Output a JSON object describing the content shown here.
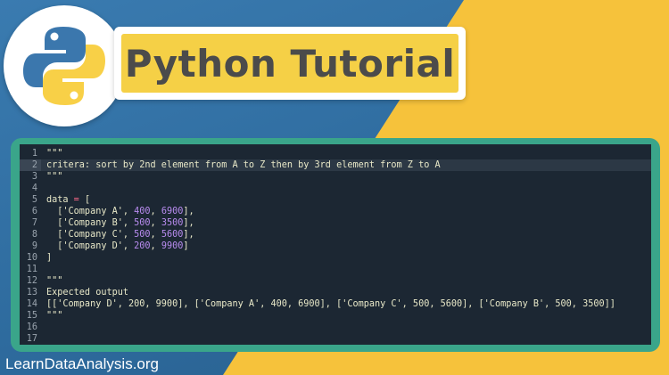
{
  "header": {
    "title": "Python Tutorial",
    "logo_icon": "python-logo-icon"
  },
  "colors": {
    "blue_bg": "#2e6b9e",
    "yellow_bg": "#f6c23b",
    "editor_bg": "#1c2733",
    "frame": "#3aa58a",
    "number": "#b98cf0",
    "operator": "#ff6b8b"
  },
  "editor": {
    "active_line": 2,
    "lines": [
      {
        "n": "1",
        "tokens": [
          {
            "t": "\"\"\"",
            "c": "str"
          }
        ]
      },
      {
        "n": "2",
        "tokens": [
          {
            "t": "critera: sort by 2nd element from A to Z then by 3rd element from Z to A",
            "c": "str"
          }
        ]
      },
      {
        "n": "3",
        "tokens": [
          {
            "t": "\"\"\"",
            "c": "str"
          }
        ]
      },
      {
        "n": "4",
        "tokens": []
      },
      {
        "n": "5",
        "tokens": [
          {
            "t": "data ",
            "c": "plain"
          },
          {
            "t": "=",
            "c": "op"
          },
          {
            "t": " [",
            "c": "plain"
          }
        ]
      },
      {
        "n": "6",
        "tokens": [
          {
            "t": "  ['Company A', ",
            "c": "plain"
          },
          {
            "t": "400",
            "c": "num"
          },
          {
            "t": ", ",
            "c": "plain"
          },
          {
            "t": "6900",
            "c": "num"
          },
          {
            "t": "],",
            "c": "plain"
          }
        ]
      },
      {
        "n": "7",
        "tokens": [
          {
            "t": "  ['Company B', ",
            "c": "plain"
          },
          {
            "t": "500",
            "c": "num"
          },
          {
            "t": ", ",
            "c": "plain"
          },
          {
            "t": "3500",
            "c": "num"
          },
          {
            "t": "],",
            "c": "plain"
          }
        ]
      },
      {
        "n": "8",
        "tokens": [
          {
            "t": "  ['Company C', ",
            "c": "plain"
          },
          {
            "t": "500",
            "c": "num"
          },
          {
            "t": ", ",
            "c": "plain"
          },
          {
            "t": "5600",
            "c": "num"
          },
          {
            "t": "],",
            "c": "plain"
          }
        ]
      },
      {
        "n": "9",
        "tokens": [
          {
            "t": "  ['Company D', ",
            "c": "plain"
          },
          {
            "t": "200",
            "c": "num"
          },
          {
            "t": ", ",
            "c": "plain"
          },
          {
            "t": "9900",
            "c": "num"
          },
          {
            "t": "]",
            "c": "plain"
          }
        ]
      },
      {
        "n": "10",
        "tokens": [
          {
            "t": "]",
            "c": "plain"
          }
        ]
      },
      {
        "n": "11",
        "tokens": []
      },
      {
        "n": "12",
        "tokens": [
          {
            "t": "\"\"\"",
            "c": "str"
          }
        ]
      },
      {
        "n": "13",
        "tokens": [
          {
            "t": "Expected output",
            "c": "str"
          }
        ]
      },
      {
        "n": "14",
        "tokens": [
          {
            "t": "[['Company D', 200, 9900], ['Company A', 400, 6900], ['Company C', 500, 5600], ['Company B', 500, 3500]]",
            "c": "str"
          }
        ]
      },
      {
        "n": "15",
        "tokens": [
          {
            "t": "\"\"\"",
            "c": "str"
          }
        ]
      },
      {
        "n": "16",
        "tokens": []
      },
      {
        "n": "17",
        "tokens": []
      }
    ]
  },
  "footer": {
    "site": "LearnDataAnalysis.org"
  }
}
